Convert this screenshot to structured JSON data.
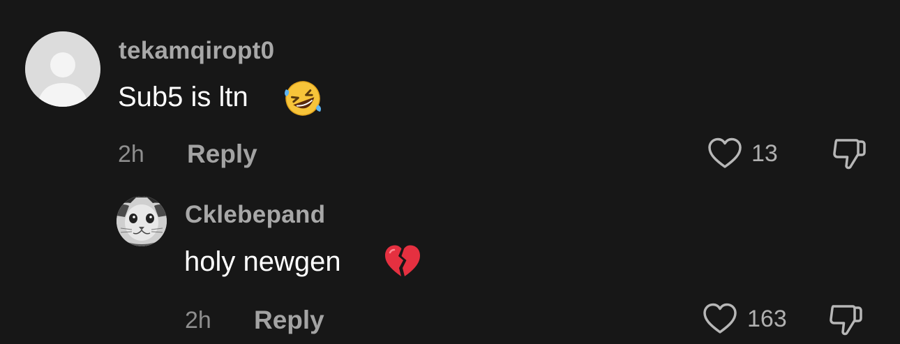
{
  "comments": [
    {
      "username": "tekamqiropt0",
      "text": "Sub5 is ltn",
      "emoji": "rolling-on-floor-laughing",
      "time": "2h",
      "reply_label": "Reply",
      "likes": "13",
      "avatar": "default-profile-icon"
    },
    {
      "username": "Cklebepand",
      "text": "holy newgen",
      "emoji": "broken-heart",
      "time": "2h",
      "reply_label": "Reply",
      "likes": "163",
      "avatar": "cat-photo"
    }
  ]
}
